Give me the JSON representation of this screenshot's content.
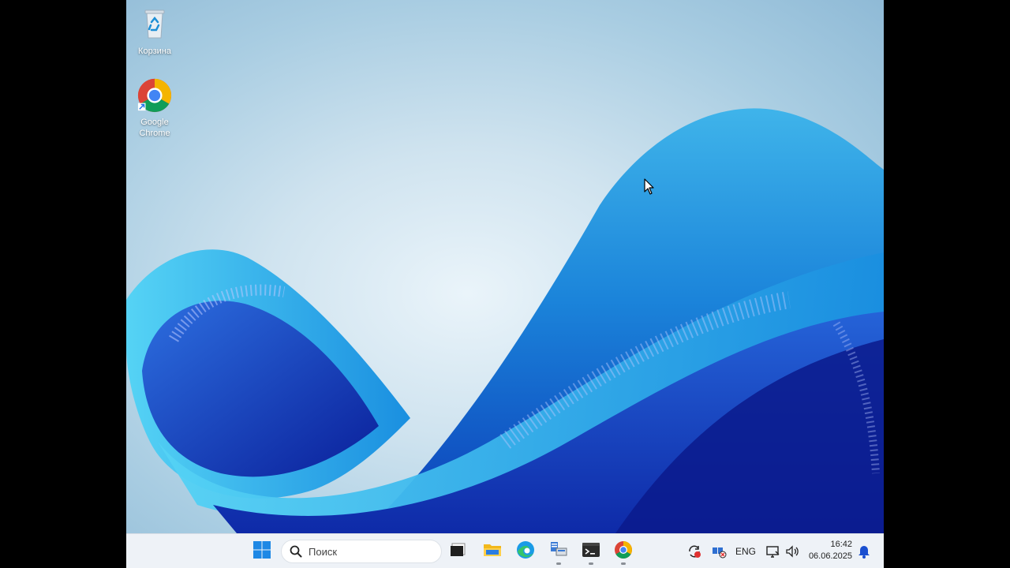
{
  "desktop": {
    "icons": [
      {
        "label": "Корзина",
        "icon": "recycle-bin-icon"
      },
      {
        "label_line1": "Google",
        "label_line2": "Chrome",
        "icon": "chrome-icon"
      }
    ]
  },
  "taskbar": {
    "search": {
      "placeholder": "Поиск"
    },
    "apps": [
      {
        "name": "start",
        "icon": "windows-logo-icon"
      },
      {
        "name": "task-view",
        "icon": "task-view-icon"
      },
      {
        "name": "file-explorer",
        "icon": "folder-icon"
      },
      {
        "name": "edge",
        "icon": "edge-icon"
      },
      {
        "name": "server-manager",
        "icon": "server-manager-icon"
      },
      {
        "name": "terminal",
        "icon": "terminal-icon"
      },
      {
        "name": "chrome",
        "icon": "chrome-icon"
      }
    ],
    "tray": {
      "language": "ENG",
      "time": "16:42",
      "date": "06.06.2025"
    }
  },
  "colors": {
    "taskbar_bg": "#eef2f7",
    "accent": "#0078d4"
  }
}
